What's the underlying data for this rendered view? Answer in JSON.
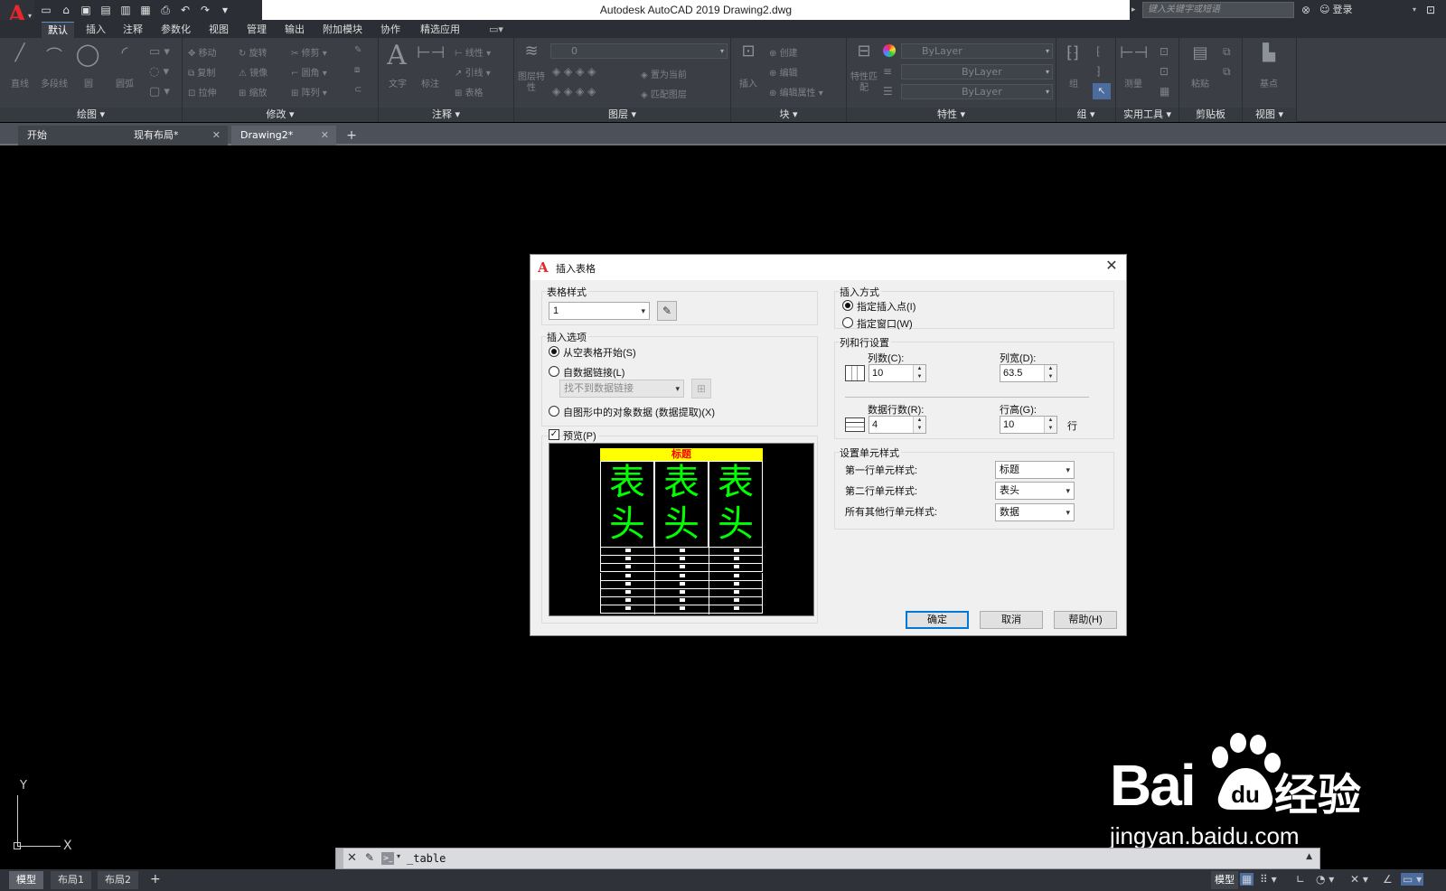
{
  "titlebar": {
    "logo": "A",
    "title": "Autodesk AutoCAD 2019    Drawing2.dwg",
    "search_placeholder": "键入关键字或短语",
    "login": "登录",
    "qat_icons": [
      "new-icon",
      "open-icon",
      "save-icon",
      "saveas-icon",
      "publish-icon",
      "plot-icon",
      "print-icon",
      "undo-icon",
      "redo-icon",
      "customize-icon"
    ]
  },
  "ribbon_tabs": [
    "默认",
    "插入",
    "注释",
    "参数化",
    "视图",
    "管理",
    "输出",
    "附加模块",
    "协作",
    "精选应用"
  ],
  "ribbon": {
    "groups": [
      "绘图",
      "修改",
      "注释",
      "图层",
      "块",
      "特性",
      "组",
      "实用工具",
      "剪贴板",
      "视图"
    ],
    "draw": {
      "line": "直线",
      "polyline": "多段线",
      "circle": "圆",
      "arc": "圆弧"
    },
    "modify": {
      "move": "移动",
      "rotate": "旋转",
      "trim": "修剪",
      "copy": "复制",
      "mirror": "镜像",
      "fillet": "圆角",
      "stretch": "拉伸",
      "scale": "缩放",
      "array": "阵列"
    },
    "annotation": {
      "text": "文字",
      "dimension": "标注",
      "linear": "线性",
      "leader": "引线",
      "table": "表格"
    },
    "layer": {
      "layer_props": "图层特性",
      "current_layer": "0",
      "set_current": "置为当前",
      "match_layer": "匹配图层"
    },
    "block": {
      "insert": "插入",
      "create": "创建",
      "edit": "编辑",
      "edit_attr": "编辑属性"
    },
    "properties": {
      "match": "特性匹配",
      "color": "ByLayer",
      "linetype": "ByLayer",
      "lineweight": "ByLayer"
    },
    "group": {
      "group": "组"
    },
    "utilities": {
      "measure": "测量"
    },
    "clipboard": {
      "paste": "粘贴"
    },
    "view": {
      "base": "基点"
    }
  },
  "doc_tabs": [
    {
      "label": "开始"
    },
    {
      "label": "现有布局*"
    },
    {
      "label": "Drawing2*"
    }
  ],
  "ucs": {
    "x": "X",
    "y": "Y"
  },
  "watermark": {
    "bai": "Bai",
    "du": "du",
    "jingyan": "经验",
    "url": "jingyan.baidu.com"
  },
  "command_line": {
    "text": "_table"
  },
  "layout_tabs": [
    "模型",
    "布局1",
    "布局2"
  ],
  "status": {
    "model": "模型"
  },
  "dialog": {
    "title": "插入表格",
    "table_style": {
      "label": "表格样式",
      "value": "1"
    },
    "insert_options": {
      "label": "插入选项",
      "from_empty": "从空表格开始(S)",
      "from_link": "自数据链接(L)",
      "link_placeholder": "找不到数据链接",
      "from_object": "自图形中的对象数据 (数据提取)(X)"
    },
    "preview": {
      "label": "预览(P)",
      "title": "标题",
      "header_top": "表",
      "header_bottom": "头"
    },
    "insert_method": {
      "label": "插入方式",
      "point": "指定插入点(I)",
      "window": "指定窗口(W)"
    },
    "col_row": {
      "label": "列和行设置",
      "columns_label": "列数(C):",
      "columns": "10",
      "col_width_label": "列宽(D):",
      "col_width": "63.5",
      "data_rows_label": "数据行数(R):",
      "data_rows": "4",
      "row_height_label": "行高(G):",
      "row_height": "10",
      "row_unit": "行"
    },
    "cell_styles": {
      "label": "设置单元样式",
      "first_row_label": "第一行单元样式:",
      "first_row": "标题",
      "second_row_label": "第二行单元样式:",
      "second_row": "表头",
      "other_rows_label": "所有其他行单元样式:",
      "other_rows": "数据"
    },
    "buttons": {
      "ok": "确定",
      "cancel": "取消",
      "help": "帮助(H)"
    }
  }
}
